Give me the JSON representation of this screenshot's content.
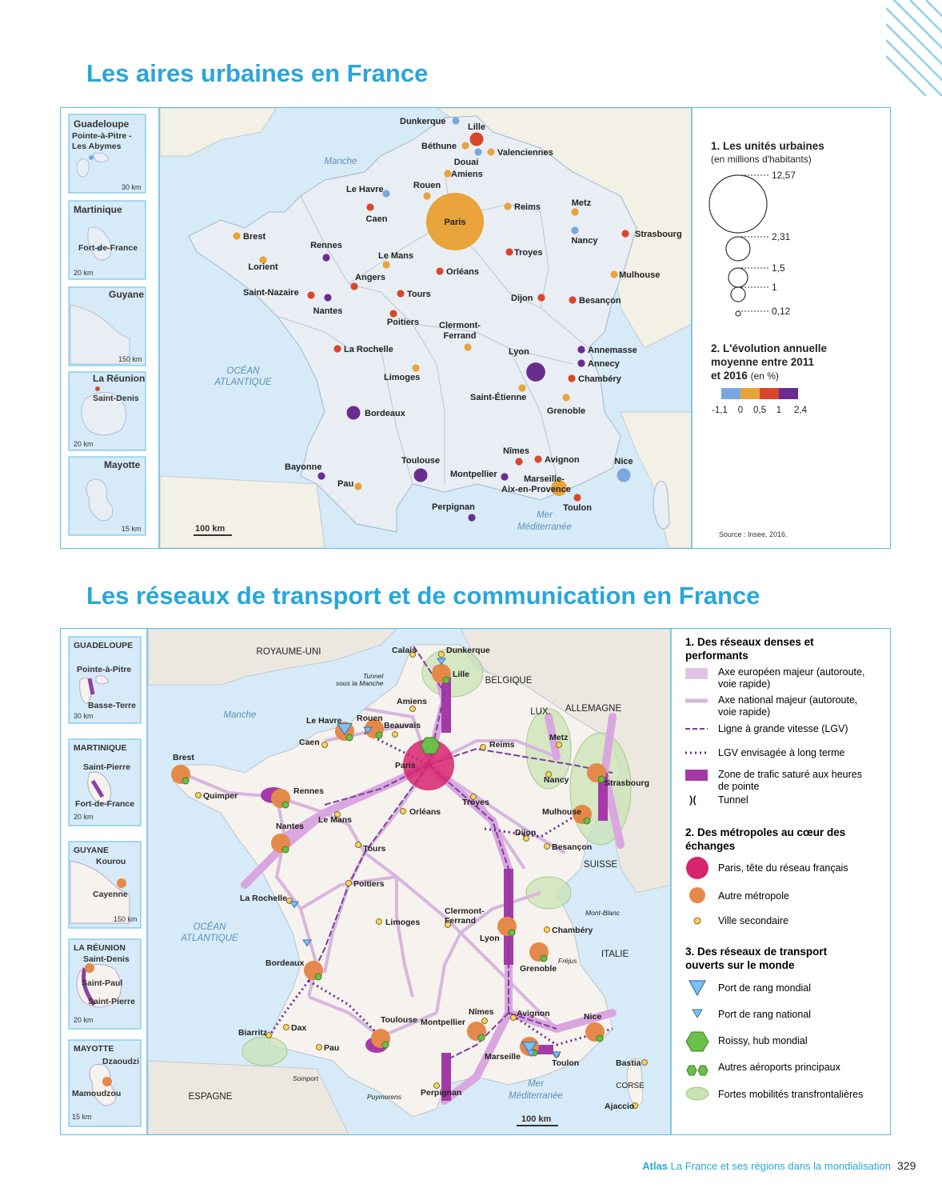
{
  "page": {
    "title_top": "Les aires urbaines en France",
    "title_bottom": "Les réseaux de transport et de communication en France",
    "footer_atlas": "Atlas",
    "footer_text": "La France et ses régions dans la mondialisation",
    "page_number": "329"
  },
  "colors": {
    "accent": "#29a6dc",
    "land": "#e9eef5",
    "sea": "#d6ebf7",
    "neighbor_land": "#f3f0e6",
    "class_1": "#79a8e0",
    "class_2": "#e8a33a",
    "class_3": "#d9472b",
    "class_4": "#6a2d8f"
  },
  "map1": {
    "insets": [
      {
        "name": "Guadeloupe",
        "city": "Pointe-à-Pitre - Les Abymes",
        "scale": "30 km"
      },
      {
        "name": "Martinique",
        "city": "Fort-de-France",
        "scale": "20 km"
      },
      {
        "name": "Guyane",
        "city": "",
        "scale": "150 km"
      },
      {
        "name": "La Réunion",
        "city": "Saint-Denis",
        "scale": "20 km"
      },
      {
        "name": "Mayotte",
        "city": "",
        "scale": "15 km"
      }
    ],
    "seas": {
      "manche": "Manche",
      "atlantique_1": "OCÉAN",
      "atlantique_2": "ATLANTIQUE",
      "med_1": "Mer",
      "med_2": "Méditerranée"
    },
    "scale": "100 km",
    "cities": [
      {
        "name": "Paris",
        "class": 2,
        "size": 12.57
      },
      {
        "name": "Lyon",
        "class": 4,
        "size": 2.31
      },
      {
        "name": "Marseille-Aix-en-Provence",
        "class": 2,
        "size": 1.5
      },
      {
        "name": "Lille",
        "class": 3,
        "size": 1
      },
      {
        "name": "Toulouse",
        "class": 4,
        "size": 1
      },
      {
        "name": "Bordeaux",
        "class": 4,
        "size": 1
      },
      {
        "name": "Nice",
        "class": 1,
        "size": 1
      },
      {
        "name": "Nantes",
        "class": 4
      },
      {
        "name": "Strasbourg",
        "class": 3
      },
      {
        "name": "Rennes",
        "class": 4
      },
      {
        "name": "Grenoble",
        "class": 2
      },
      {
        "name": "Rouen",
        "class": 2
      },
      {
        "name": "Toulon",
        "class": 3
      },
      {
        "name": "Montpellier",
        "class": 4
      },
      {
        "name": "Saint-Étienne",
        "class": 2
      },
      {
        "name": "Dunkerque",
        "class": 1
      },
      {
        "name": "Béthune",
        "class": 2
      },
      {
        "name": "Valenciennes",
        "class": 2
      },
      {
        "name": "Douai",
        "class": 1
      },
      {
        "name": "Amiens",
        "class": 2
      },
      {
        "name": "Le Havre",
        "class": 1
      },
      {
        "name": "Caen",
        "class": 3
      },
      {
        "name": "Reims",
        "class": 2
      },
      {
        "name": "Metz",
        "class": 2
      },
      {
        "name": "Nancy",
        "class": 1
      },
      {
        "name": "Brest",
        "class": 2
      },
      {
        "name": "Lorient",
        "class": 2
      },
      {
        "name": "Le Mans",
        "class": 2
      },
      {
        "name": "Troyes",
        "class": 3
      },
      {
        "name": "Mulhouse",
        "class": 2
      },
      {
        "name": "Orléans",
        "class": 3
      },
      {
        "name": "Angers",
        "class": 3
      },
      {
        "name": "Saint-Nazaire",
        "class": 3
      },
      {
        "name": "Tours",
        "class": 3
      },
      {
        "name": "Dijon",
        "class": 3
      },
      {
        "name": "Besançon",
        "class": 3
      },
      {
        "name": "Poitiers",
        "class": 3
      },
      {
        "name": "La Rochelle",
        "class": 3
      },
      {
        "name": "Clermont-Ferrand",
        "class": 2
      },
      {
        "name": "Limoges",
        "class": 2
      },
      {
        "name": "Annemasse",
        "class": 4
      },
      {
        "name": "Annecy",
        "class": 4
      },
      {
        "name": "Chambéry",
        "class": 3
      },
      {
        "name": "Nîmes",
        "class": 3
      },
      {
        "name": "Avignon",
        "class": 3
      },
      {
        "name": "Bayonne",
        "class": 4
      },
      {
        "name": "Pau",
        "class": 2
      },
      {
        "name": "Perpignan",
        "class": 4
      }
    ],
    "legend": {
      "h1": "1. Les unités urbaines",
      "h1_sub": "(en millions d'habitants)",
      "sizes": [
        "12,57",
        "2,31",
        "1,5",
        "1",
        "0,12"
      ],
      "size_values": [
        12.57,
        2.31,
        1.5,
        1,
        0.12
      ],
      "h2_1": "2. L'évolution annuelle",
      "h2_2": "moyenne entre 2011",
      "h2_3": "et 2016",
      "h2_unit": "(en %)",
      "breaks": [
        "-1,1",
        "0",
        "0,5",
        "1",
        "2,4"
      ],
      "source": "Source : Insee, 2016."
    }
  },
  "map2": {
    "insets": [
      {
        "name": "GUADELOUPE",
        "cities": [
          "Pointe-à-Pitre",
          "Basse-Terre"
        ],
        "scale": "30 km"
      },
      {
        "name": "MARTINIQUE",
        "cities": [
          "Saint-Pierre",
          "Fort-de-France"
        ],
        "scale": "20 km"
      },
      {
        "name": "GUYANE",
        "cities": [
          "Kourou",
          "Cayenne"
        ],
        "scale": "150 km"
      },
      {
        "name": "LA RÉUNION",
        "cities": [
          "Saint-Denis",
          "Saint-Paul",
          "Saint-Pierre"
        ],
        "scale": "20 km"
      },
      {
        "name": "MAYOTTE",
        "cities": [
          "Dzaoudzi",
          "Mamoudzou"
        ],
        "scale": "15 km"
      }
    ],
    "countries": {
      "uk": "ROYAUME-UNI",
      "be": "BELGIQUE",
      "lux": "LUX.",
      "de": "ALLEMAGNE",
      "ch": "SUISSE",
      "it": "ITALIE",
      "es": "ESPAGNE",
      "corse": "CORSE"
    },
    "seas": {
      "manche": "Manche",
      "atl_1": "OCÉAN",
      "atl_2": "ATLANTIQUE",
      "med_1": "Mer",
      "med_2": "Méditerranée"
    },
    "tunnels": {
      "manche_1": "Tunnel",
      "manche_2": "sous la Manche",
      "mont_blanc": "Mont-Blanc",
      "frejus": "Fréjus",
      "somport": "Somport",
      "puymorens": "Puymorens"
    },
    "scale": "100 km",
    "cities": [
      "Calais",
      "Dunkerque",
      "Lille",
      "Amiens",
      "Le Havre",
      "Rouen",
      "Beauvais",
      "Caen",
      "Reims",
      "Metz",
      "Nancy",
      "Strasbourg",
      "Brest",
      "Quimper",
      "Rennes",
      "Le Mans",
      "Paris",
      "Troyes",
      "Orléans",
      "Mulhouse",
      "Dijon",
      "Besançon",
      "Nantes",
      "Tours",
      "Poitiers",
      "La Rochelle",
      "Limoges",
      "Clermont-Ferrand",
      "Lyon",
      "Chambéry",
      "Grenoble",
      "Bordeaux",
      "Biarritz",
      "Dax",
      "Pau",
      "Toulouse",
      "Montpellier",
      "Nîmes",
      "Avignon",
      "Marseille",
      "Toulon",
      "Nice",
      "Perpignan",
      "Bastia",
      "Ajaccio"
    ],
    "legend": {
      "h1_1": "1. Des réseaux denses et",
      "h1_2": "performants",
      "l1a_1": "Axe européen majeur (autoroute,",
      "l1a_2": "voie rapide)",
      "l1b_1": "Axe national  majeur (autoroute,",
      "l1b_2": "voie rapide)",
      "l1c": "Ligne à grande vitesse (LGV)",
      "l1d": "LGV envisagée à long terme",
      "l1e_1": "Zone de trafic saturé aux heures",
      "l1e_2": "de pointe",
      "l1f": "Tunnel",
      "h2_1": "2. Des métropoles au cœur des",
      "h2_2": "échanges",
      "l2a": "Paris, tête du réseau français",
      "l2b": "Autre métropole",
      "l2c": "Ville secondaire",
      "h3_1": "3. Des réseaux de transport",
      "h3_2": "ouverts sur le monde",
      "l3a": "Port de rang mondial",
      "l3b": "Port de rang national",
      "l3c": "Roissy, hub mondial",
      "l3d": "Autres aéroports principaux",
      "l3e": "Fortes mobilités transfrontalières"
    }
  }
}
